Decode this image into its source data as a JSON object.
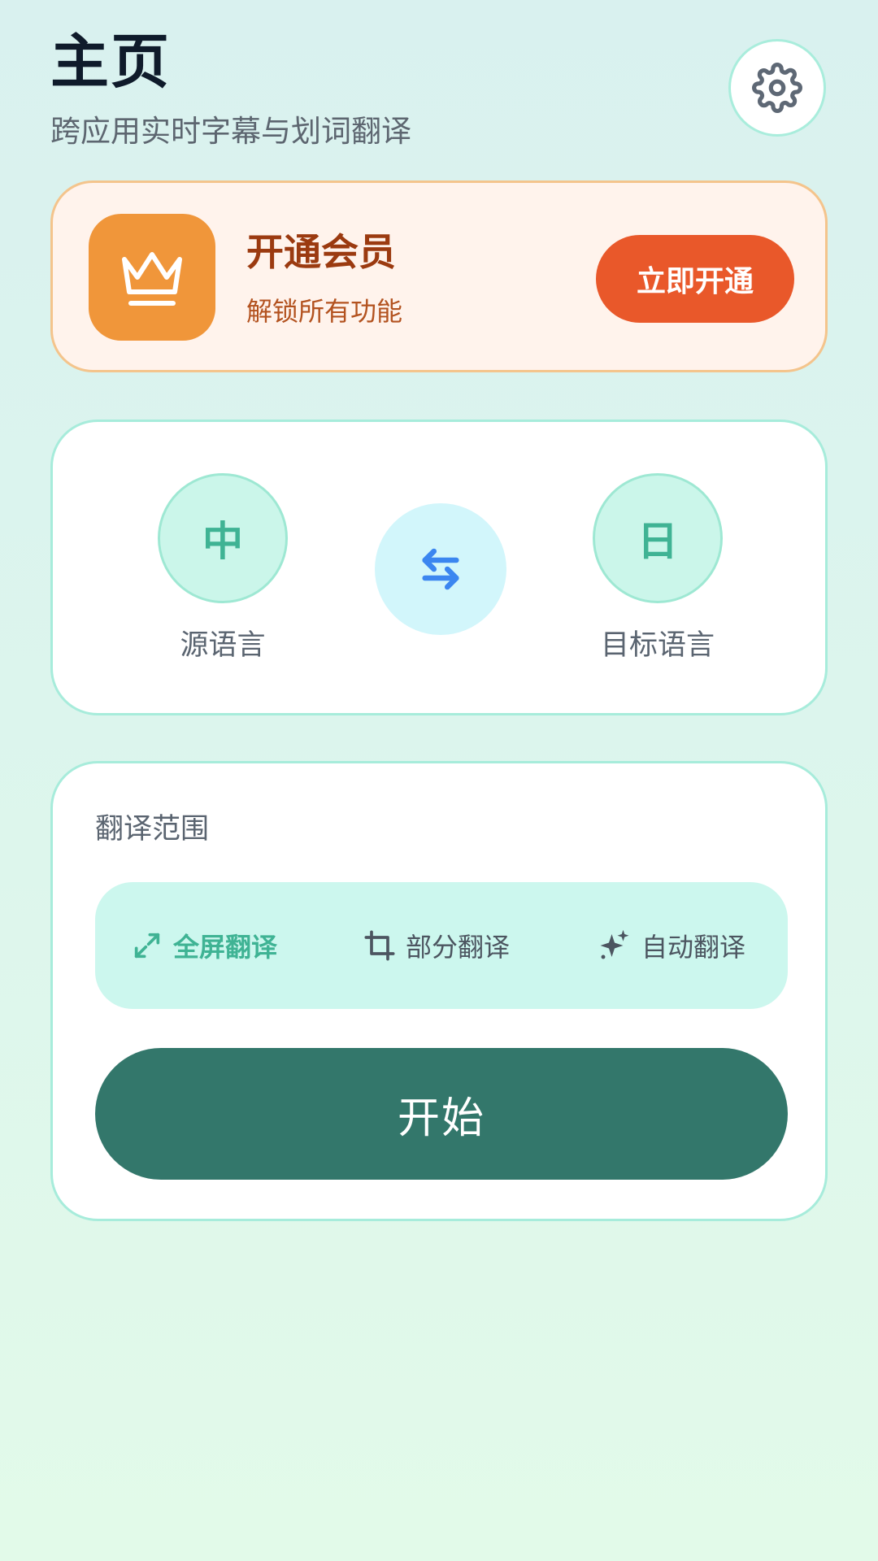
{
  "header": {
    "title": "主页",
    "subtitle": "跨应用实时字幕与划词翻译",
    "settings_icon": "gear-icon"
  },
  "membership": {
    "icon": "crown-icon",
    "title": "开通会员",
    "subtitle": "解锁所有功能",
    "button_label": "立即开通"
  },
  "languages": {
    "source": {
      "code": "中",
      "label": "源语言"
    },
    "target": {
      "code": "日",
      "label": "目标语言"
    },
    "swap_icon": "swap-arrows-icon"
  },
  "range": {
    "title": "翻译范围",
    "options": [
      {
        "label": "全屏翻译",
        "icon": "expand-icon",
        "selected": true
      },
      {
        "label": "部分翻译",
        "icon": "crop-icon",
        "selected": false
      },
      {
        "label": "自动翻译",
        "icon": "sparkle-icon",
        "selected": false
      }
    ]
  },
  "start_button": {
    "label": "开始"
  },
  "colors": {
    "accent_green": "#3fb394",
    "start_button": "#33776b",
    "vip_orange": "#f0963a",
    "vip_button": "#e9582a",
    "swap_blue": "#3b86f0"
  }
}
